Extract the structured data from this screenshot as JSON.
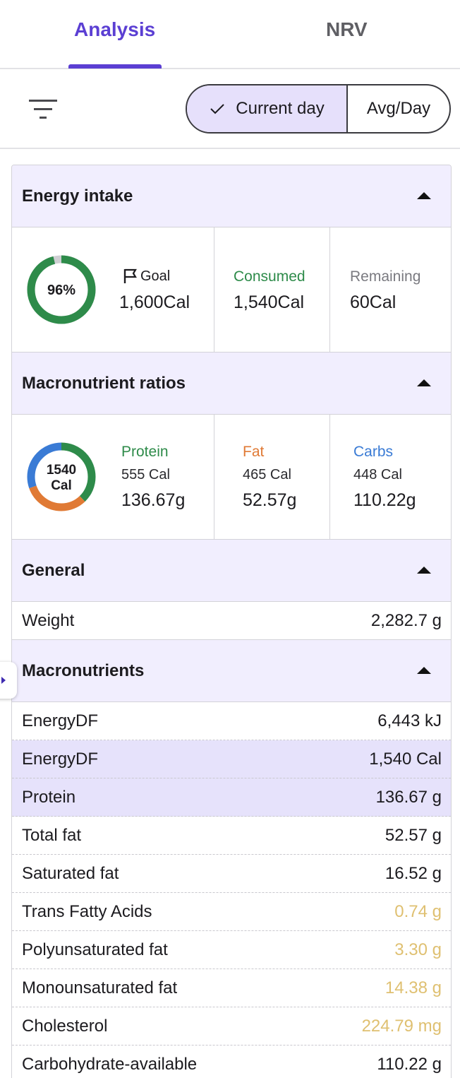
{
  "tabs": [
    {
      "label": "Analysis",
      "active": true
    },
    {
      "label": "NRV",
      "active": false
    }
  ],
  "toolbar": {
    "filter_icon": "filter-icon",
    "segments": [
      {
        "label": "Current day",
        "selected": true
      },
      {
        "label": "Avg/Day",
        "selected": false
      }
    ]
  },
  "energy": {
    "title": "Energy intake",
    "percent_label": "96%",
    "percent": 0.96,
    "goal_label": "Goal",
    "goal_value": "1,600Cal",
    "consumed_label": "Consumed",
    "consumed_value": "1,540Cal",
    "remaining_label": "Remaining",
    "remaining_value": "60Cal"
  },
  "macros": {
    "title": "Macronutrient ratios",
    "center_value": "1540",
    "center_unit": "Cal",
    "items": [
      {
        "name": "Protein",
        "cal": "555 Cal",
        "grams": "136.67g",
        "color": "#2e8b4a",
        "value": 555
      },
      {
        "name": "Fat",
        "cal": "465 Cal",
        "grams": "52.57g",
        "color": "#e07a35",
        "value": 465
      },
      {
        "name": "Carbs",
        "cal": "448 Cal",
        "grams": "110.22g",
        "color": "#3a7bd5",
        "value": 448
      }
    ]
  },
  "general": {
    "title": "General",
    "rows": [
      {
        "label": "Weight",
        "value": "2,282.7 g"
      }
    ]
  },
  "macronutrients": {
    "title": "Macronutrients",
    "rows": [
      {
        "label": "EnergyDF",
        "value": "6,443 kJ",
        "highlight": false,
        "warn": false
      },
      {
        "label": "EnergyDF",
        "value": "1,540 Cal",
        "highlight": true,
        "warn": false
      },
      {
        "label": "Protein",
        "value": "136.67 g",
        "highlight": true,
        "warn": false
      },
      {
        "label": "Total fat",
        "value": "52.57 g",
        "highlight": false,
        "warn": false
      },
      {
        "label": "Saturated fat",
        "value": "16.52 g",
        "highlight": false,
        "warn": false
      },
      {
        "label": "Trans Fatty Acids",
        "value": "0.74 g",
        "highlight": false,
        "warn": true
      },
      {
        "label": "Polyunsaturated fat",
        "value": "3.30 g",
        "highlight": false,
        "warn": true
      },
      {
        "label": "Monounsaturated fat",
        "value": "14.38 g",
        "highlight": false,
        "warn": true
      },
      {
        "label": "Cholesterol",
        "value": "224.79 mg",
        "highlight": false,
        "warn": true
      },
      {
        "label": "Carbohydrate-available",
        "value": "110.22 g",
        "highlight": false,
        "warn": false
      }
    ]
  },
  "colors": {
    "accent": "#5b3fd3",
    "consumed": "#2e8b4a",
    "remaining": "#7a7a80",
    "warn": "#dfc071",
    "section_bg": "#f1eefe",
    "highlight_row": "#e6e2fb"
  }
}
